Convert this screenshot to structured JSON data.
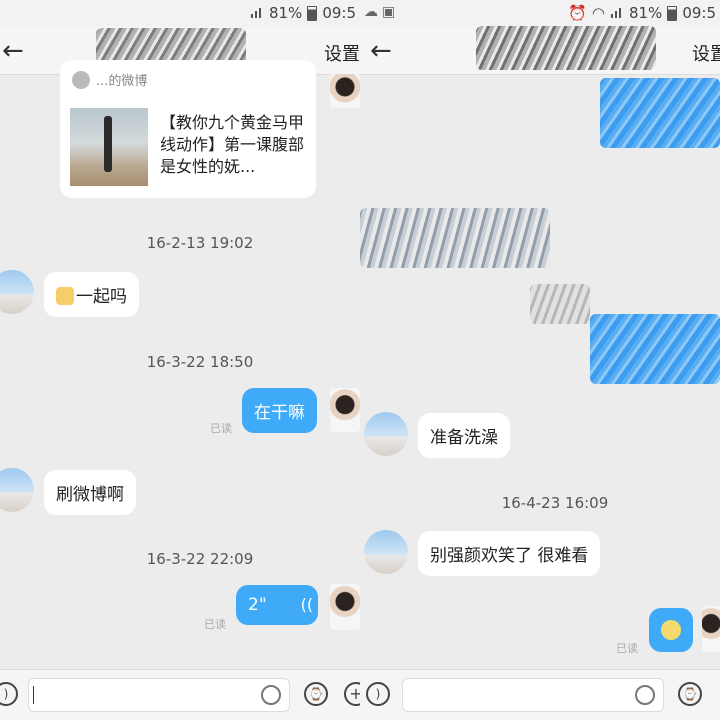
{
  "status_left": {
    "battery": "81%",
    "time": "09:5"
  },
  "status_right": {
    "battery": "81%",
    "time": "09:5"
  },
  "left_panel": {
    "nav": {
      "back": "←",
      "title": "设置"
    },
    "share_card": {
      "source": "...的微博",
      "text": "【教你九个黄金马甲线动作】第一课腹部是女性的妩..."
    },
    "messages": [
      {
        "time": "16-2-13 19:02"
      },
      {
        "text": "一起吗"
      },
      {
        "time": "16-3-22 18:50"
      },
      {
        "text": "在干嘛",
        "read": "已读"
      },
      {
        "text": "刷微博啊"
      },
      {
        "time": "16-3-22 22:09"
      },
      {
        "voice": "2\"",
        "voice_icon": "((",
        "read": "已读"
      }
    ],
    "input": {
      "voice_icon": "voice-icon",
      "emoji_icon": "smile-icon",
      "clock_icon": "clock-icon",
      "plus_icon": "plus-icon",
      "plus_label": "+"
    }
  },
  "right_panel": {
    "nav": {
      "back": "←",
      "title": "设置"
    },
    "messages": [
      {
        "text": "准备洗澡"
      },
      {
        "time": "16-4-23 16:09"
      },
      {
        "text": "别强颜欢笑了  很难看"
      },
      {
        "sticker": "emoji-sticker",
        "read": "已读"
      }
    ]
  }
}
